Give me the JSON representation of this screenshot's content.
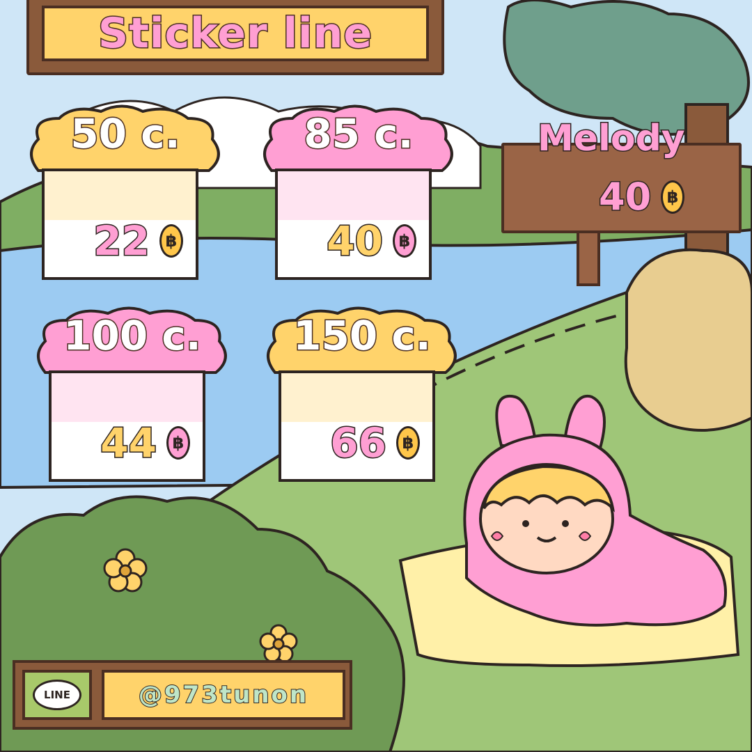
{
  "title": "Sticker line",
  "packages": [
    {
      "amount": "50 c.",
      "price": "22",
      "cloud_color": "#ffd36b",
      "band_color": "#fff1cf",
      "price_color": "#ff9fd3",
      "coin_color": "#ffc64a"
    },
    {
      "amount": "85 c.",
      "price": "40",
      "cloud_color": "#ff9fd3",
      "band_color": "#ffe4f1",
      "price_color": "#ffd36b",
      "coin_color": "#ff9fd3"
    },
    {
      "amount": "100 c.",
      "price": "44",
      "cloud_color": "#ff9fd3",
      "band_color": "#ffe4f1",
      "price_color": "#ffd36b",
      "coin_color": "#ff9fd3"
    },
    {
      "amount": "150 c.",
      "price": "66",
      "cloud_color": "#ffd36b",
      "band_color": "#fff1cf",
      "price_color": "#ff9fd3",
      "coin_color": "#ffc64a"
    }
  ],
  "melody": {
    "name": "Melody",
    "price": "40"
  },
  "currency_symbol": "฿",
  "line": {
    "badge": "LINE",
    "handle": "@973tunon"
  },
  "colors": {
    "sky": "#cfe6f7",
    "river": "#9ccbf2",
    "grass": "#8fb86a",
    "bush": "#6f9a55",
    "tree": "#6f9f8c",
    "wood": "#9a6446",
    "outline": "#2d2421",
    "pink": "#ff9fd3",
    "yellow": "#ffd36b"
  },
  "icons": [
    "coin-icon",
    "line-logo-icon",
    "flower-icon",
    "bunny-character-icon"
  ]
}
